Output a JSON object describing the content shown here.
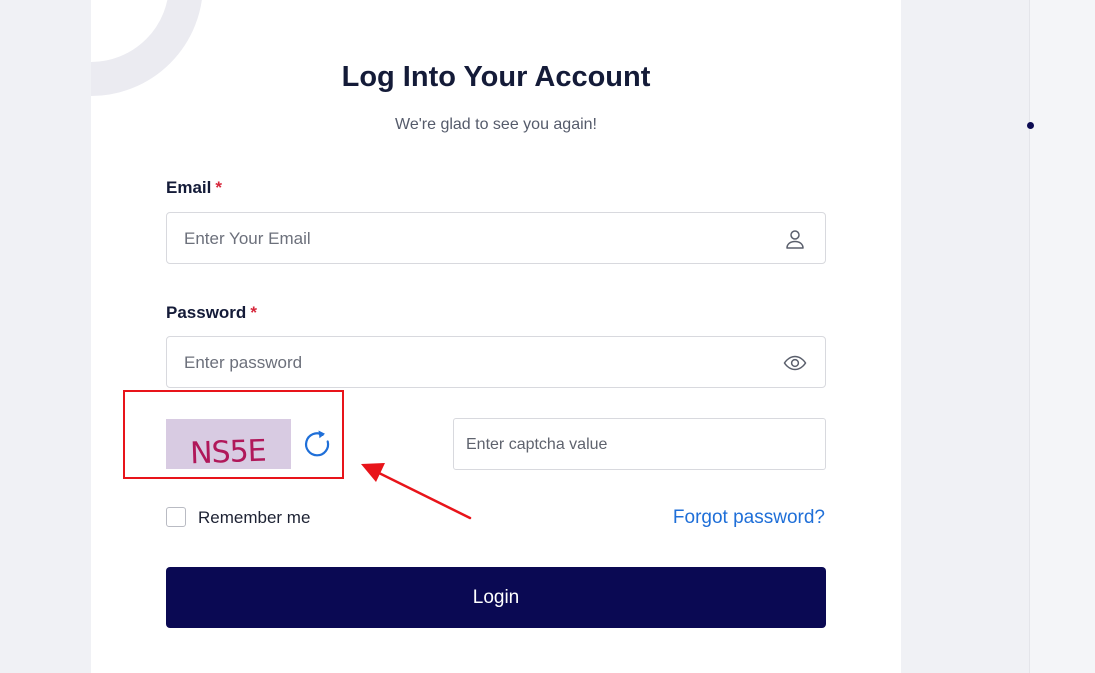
{
  "login": {
    "title": "Log Into Your Account",
    "subtitle": "We're glad to see you again!",
    "email_label": "Email",
    "email_placeholder": "Enter Your Email",
    "password_label": "Password",
    "password_placeholder": "Enter password",
    "required_mark": "*",
    "captcha_text": "NS5E",
    "captcha_placeholder": "Enter captcha value",
    "remember_label": "Remember me",
    "forgot_label": "Forgot password?",
    "login_button": "Login"
  },
  "icons": {
    "email_field": "user-icon",
    "password_field": "eye-icon",
    "captcha_refresh": "refresh-icon"
  },
  "colors": {
    "primary": "#0a0953",
    "link": "#1f6fd8",
    "required": "#d6263a",
    "annotation": "#e8141a",
    "captcha_bg": "#d8cbe2",
    "captcha_text": "#b0185a"
  }
}
